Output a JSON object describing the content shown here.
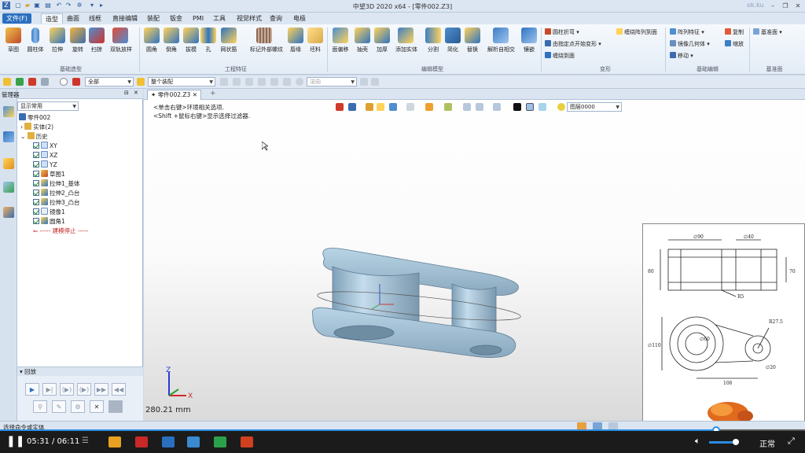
{
  "app": {
    "title": "中望3D 2020 x64 - [零件002.Z3]",
    "watermark": "ok.ku"
  },
  "menu": {
    "items": [
      "文件(F)",
      "造型",
      "曲面",
      "线框",
      "直接编辑",
      "装配",
      "钣金",
      "PMI",
      "工具",
      "视觉样式",
      "查询",
      "电极"
    ],
    "active": "造型"
  },
  "ribbon": {
    "groups": [
      {
        "name": "基础造型",
        "tools": [
          "草图",
          "圆柱体",
          "拉伸",
          "旋转",
          "扫掠",
          "双轨放样"
        ]
      },
      {
        "name": "工程特征",
        "tools": [
          "圆角",
          "倒角",
          "拔模",
          "孔",
          "网状筋",
          "标记外部螺纹",
          "唇缘",
          "坯料"
        ]
      },
      {
        "name": "编辑模型",
        "tools": [
          "面偏移",
          "抽壳",
          "加厚",
          "添加实体",
          "分割",
          "简化",
          "替换",
          "解析自相交",
          "镶嵌"
        ]
      },
      {
        "name": "变形",
        "tools": [
          "圆柱折弯",
          "由指定点开始变形",
          "缠绕到面",
          "缠绕阵列到面"
        ]
      },
      {
        "name": "基础编辑",
        "tools": [
          "阵列特征",
          "镜像几何体",
          "移动",
          "复制",
          "缩放"
        ]
      },
      {
        "name": "基准面",
        "tools": [
          "基准面"
        ]
      }
    ]
  },
  "filterbar": {
    "filter_value": "全部",
    "assembly_value": "整个装配",
    "direction_placeholder": "法向"
  },
  "manager": {
    "title": "管理器",
    "view_select": "显示常用",
    "tree": {
      "root": "零件002",
      "solids": "实体(2)",
      "history": "历史",
      "items": [
        "XY",
        "XZ",
        "YZ",
        "草图1",
        "拉伸1_基体",
        "拉伸2_凸台",
        "拉伸3_凸台",
        "镜像1",
        "圆角1"
      ],
      "stop": "----- 建模停止 -----"
    },
    "playback_title": "回放"
  },
  "viewport": {
    "tab_label": "零件002.Z3",
    "hint_line1": "<单击右键>环境相关选项.",
    "hint_line2": "<Shift +鼠标右键>显示选择过滤器.",
    "layer": "图层0000",
    "measure": "280.21 mm"
  },
  "drawing": {
    "dims": [
      "∅90",
      "∅40",
      "80",
      "70",
      "R5",
      "R27.5",
      "∅110",
      "∅60",
      "∅20",
      "106"
    ]
  },
  "status": {
    "text": "选择命令或实体"
  },
  "player": {
    "time": "05:31 / 06:11",
    "speed": "正常",
    "progress": 0.891
  }
}
